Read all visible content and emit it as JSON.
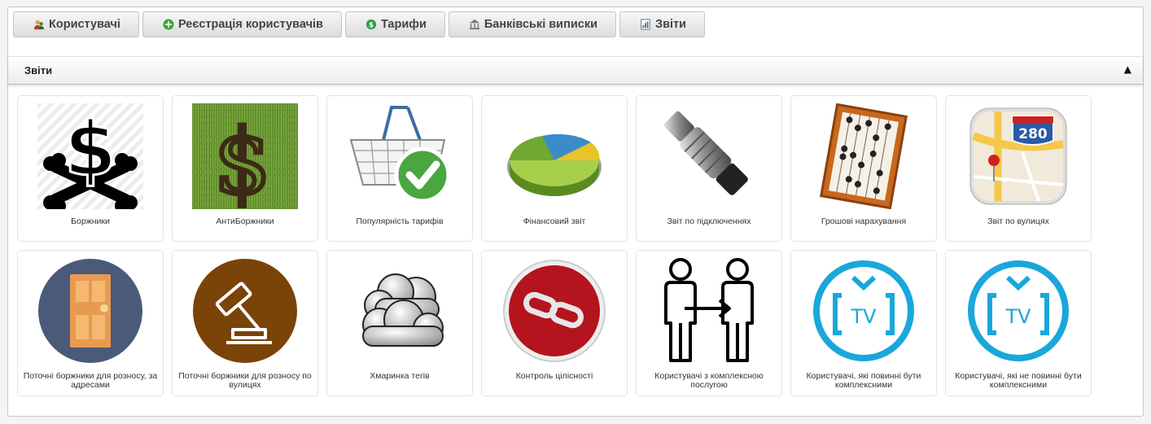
{
  "tabs": [
    {
      "label": "Користувачі",
      "icon": "users-icon"
    },
    {
      "label": "Реєстрація користувачів",
      "icon": "add-circle-icon"
    },
    {
      "label": "Тарифи",
      "icon": "dollar-coin-icon"
    },
    {
      "label": "Банківські виписки",
      "icon": "bank-icon"
    },
    {
      "label": "Звіти",
      "icon": "report-icon"
    }
  ],
  "panel": {
    "title": "Звіти",
    "collapse_glyph": "▲"
  },
  "reports": [
    {
      "label": "Боржники",
      "icon": "dollar-crossbones-icon"
    },
    {
      "label": "АнтиБоржники",
      "icon": "dollar-grass-icon"
    },
    {
      "label": "Популярність тарифів",
      "icon": "basket-check-icon"
    },
    {
      "label": "Фінансовий звіт",
      "icon": "pie-chart-icon"
    },
    {
      "label": "Звіт по підключеннях",
      "icon": "coax-connector-icon"
    },
    {
      "label": "Грошові нарахування",
      "icon": "abacus-icon"
    },
    {
      "label": "Звіт по вулицях",
      "icon": "map-icon"
    },
    {
      "label": "Поточні боржники для розносу, за адресами",
      "icon": "door-icon"
    },
    {
      "label": "Поточні боржники для розносу по вулицях",
      "icon": "gavel-icon"
    },
    {
      "label": "Хмаринка тегів",
      "icon": "cloud-icon"
    },
    {
      "label": "Контроль цілісності",
      "icon": "chain-link-icon"
    },
    {
      "label": "Користувачі з комплексною послугою",
      "icon": "people-transfer-icon"
    },
    {
      "label": "Користувачі, які повинні бути комплексними",
      "icon": "tv-icon"
    },
    {
      "label": "Користувачі, які не повинні бути комплексними",
      "icon": "tv-icon"
    }
  ],
  "map_badge": "280",
  "tv_text": "TV",
  "colors": {
    "tv_blue": "#1aa7dc",
    "door_bg": "#4a5a78",
    "gavel_bg": "#7a4308",
    "chain_bg": "#b4141d"
  }
}
